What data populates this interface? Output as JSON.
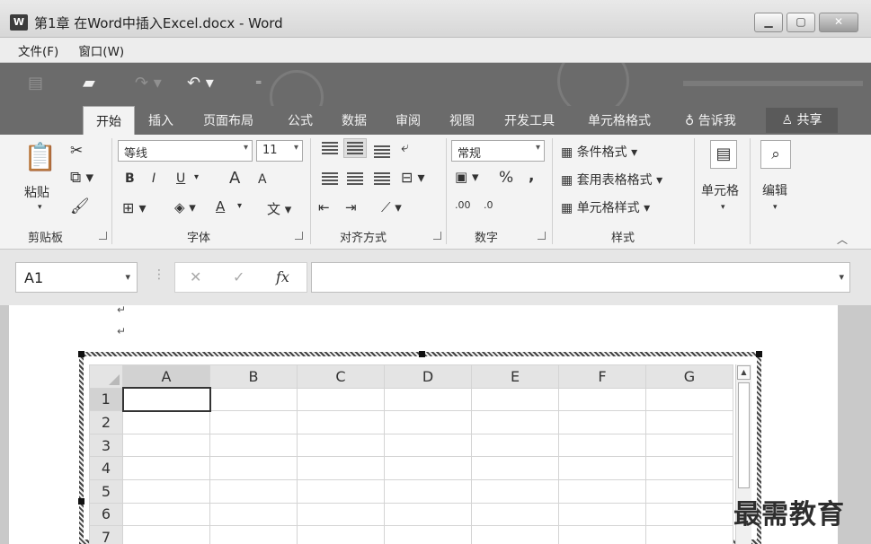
{
  "window": {
    "title": "第1章  在Word中插入Excel.docx - Word",
    "app_icon_letter": "W"
  },
  "menubar": {
    "items": [
      "文件(F)",
      "窗口(W)"
    ]
  },
  "ribbon_tabs": {
    "active": "开始",
    "items": [
      "插入",
      "页面布局",
      "公式",
      "数据",
      "审阅",
      "视图",
      "开发工具",
      "单元格格式"
    ],
    "tell_me": "告诉我",
    "share": "共享"
  },
  "ribbon": {
    "clipboard": {
      "paste": "粘贴",
      "label": "剪贴板"
    },
    "font": {
      "name": "等线",
      "size": "11",
      "bold": "B",
      "italic": "I",
      "underline": "U",
      "grow": "A",
      "shrink": "A",
      "font_color": "A",
      "label": "字体"
    },
    "alignment": {
      "label": "对齐方式"
    },
    "number": {
      "format": "常规",
      "percent": "%",
      "comma": ",",
      "inc_decimal": ".00",
      "dec_decimal": ".0",
      "label": "数字"
    },
    "styles": {
      "conditional": "条件格式",
      "table": "套用表格格式",
      "cell_styles": "单元格样式",
      "label": "样式"
    },
    "cells": {
      "label": "单元格"
    },
    "editing": {
      "label": "编辑"
    }
  },
  "formula_bar": {
    "name_box": "A1",
    "cancel": "✕",
    "enter": "✓",
    "fx": "fx",
    "value": ""
  },
  "sheet": {
    "columns": [
      "A",
      "B",
      "C",
      "D",
      "E",
      "F",
      "G"
    ],
    "rows": [
      "1",
      "2",
      "3",
      "4",
      "5",
      "6",
      "7"
    ],
    "active_cell": "A1"
  },
  "watermark": "最需教育"
}
